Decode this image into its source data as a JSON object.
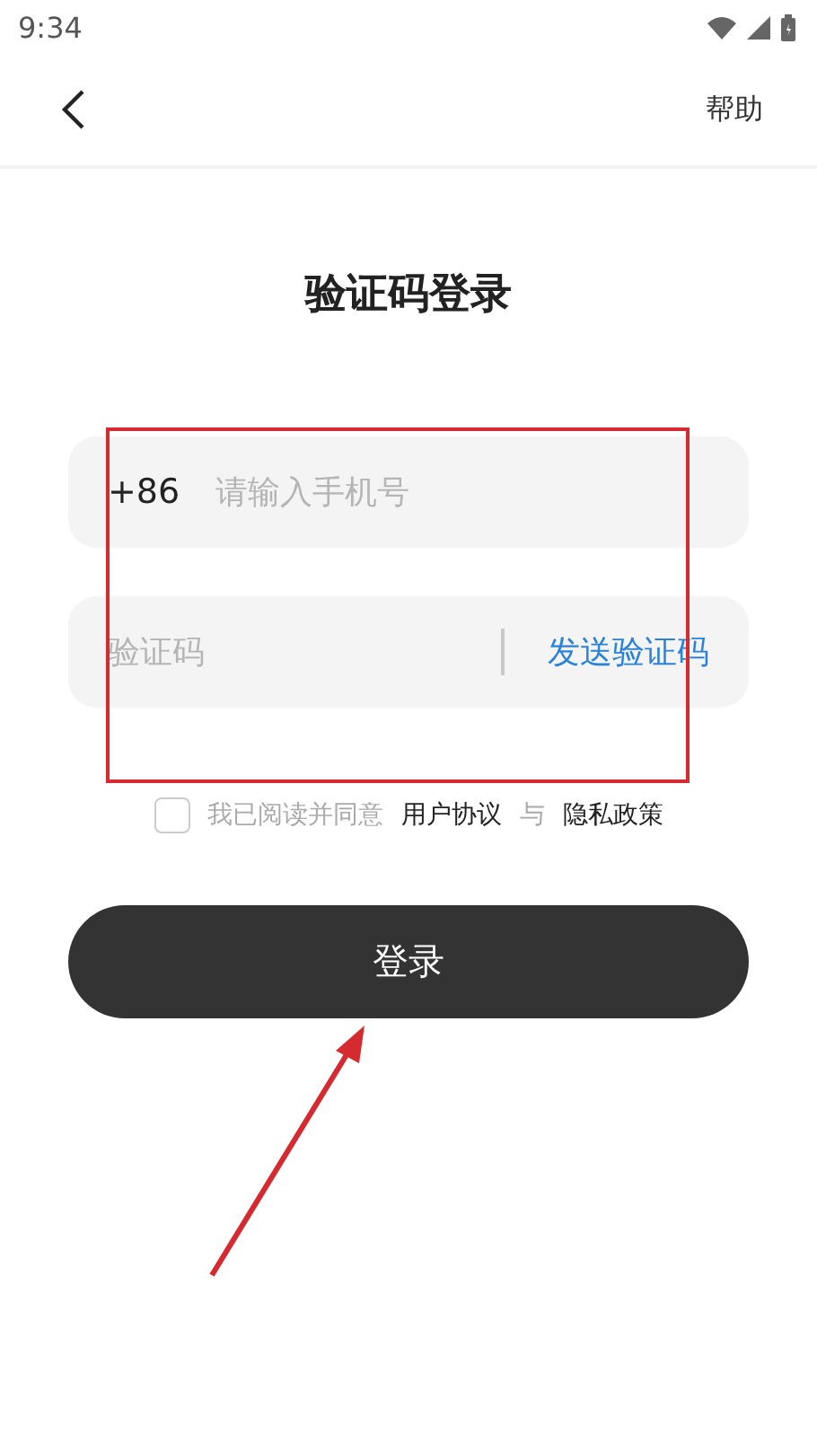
{
  "status_bar": {
    "time": "9:34"
  },
  "header": {
    "help": "帮助"
  },
  "title": "验证码登录",
  "phone_field": {
    "prefix": "+86",
    "placeholder": "请输入手机号"
  },
  "code_field": {
    "placeholder": "验证码",
    "send_button": "发送验证码"
  },
  "agreement": {
    "checked": false,
    "text": "我已阅读并同意",
    "links": [
      "用户协议",
      "隐私政策"
    ],
    "joiner": "与"
  },
  "login_button": "登录",
  "annotations": [
    {
      "kind": "frame"
    },
    {
      "kind": "arrow"
    }
  ]
}
